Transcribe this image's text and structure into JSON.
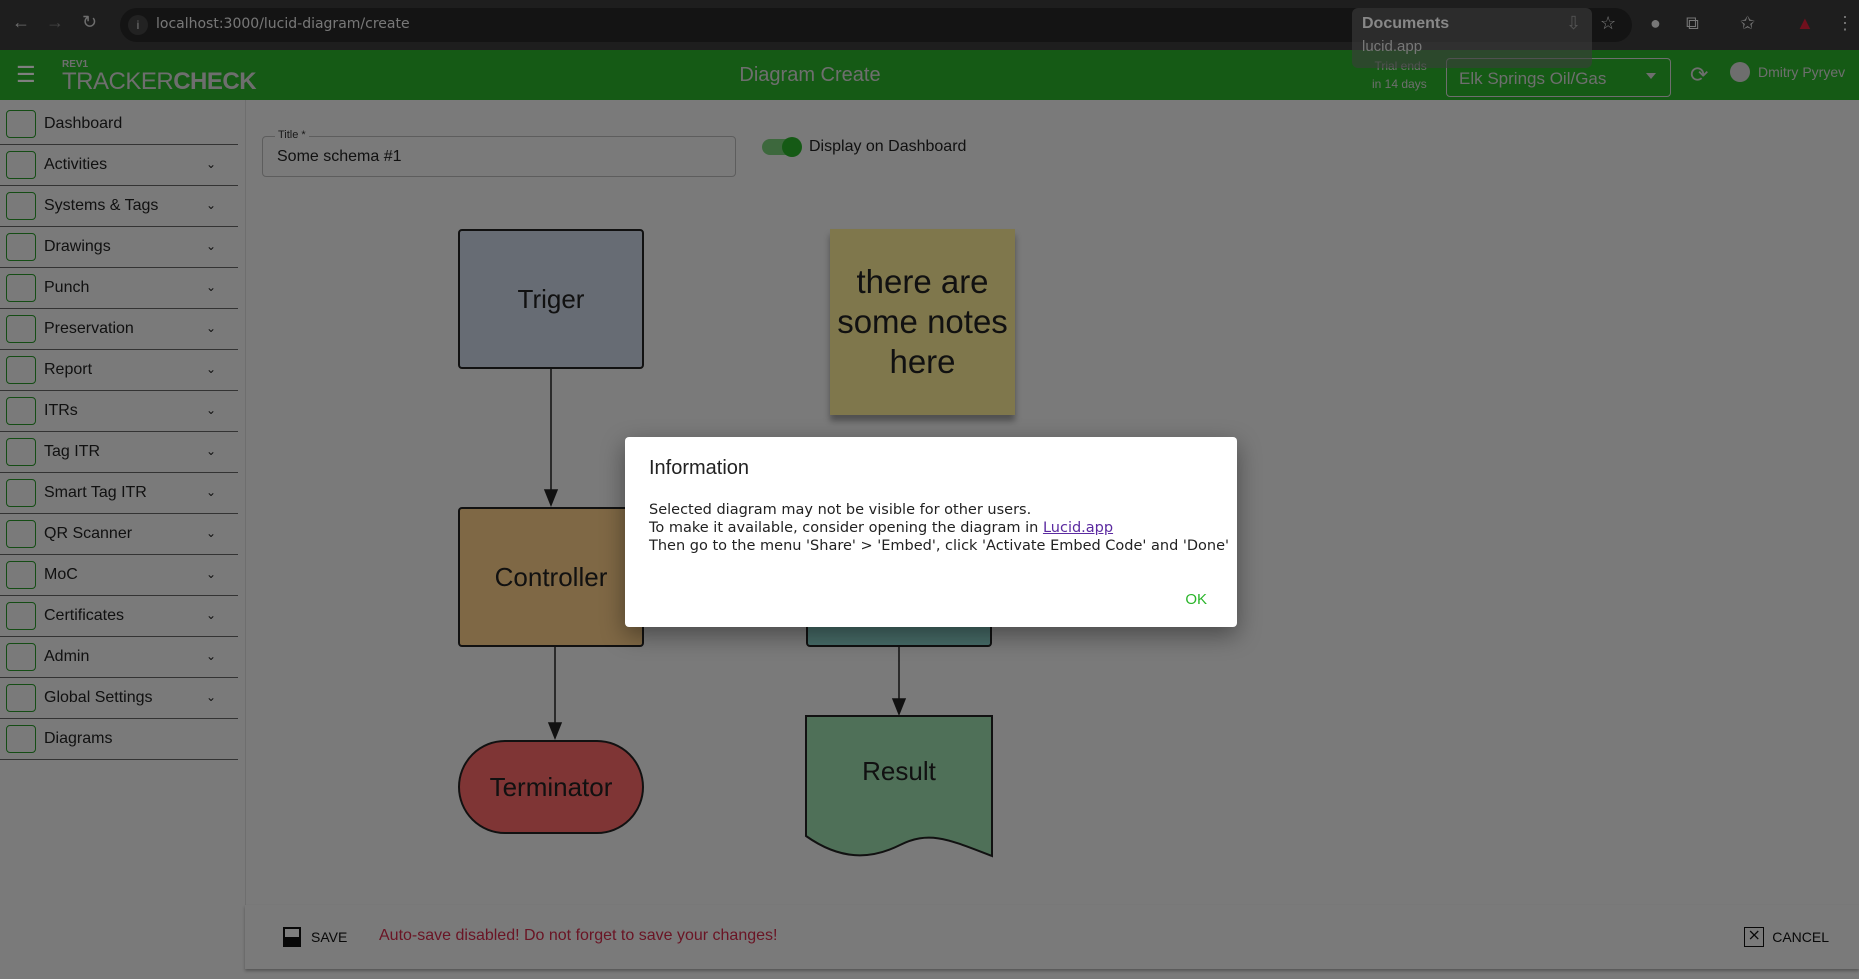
{
  "browser": {
    "url": "localhost:3000/lucid-diagram/create",
    "tooltip_title": "Documents",
    "tooltip_sub": "lucid.app"
  },
  "header": {
    "logo_rev": "REV1",
    "logo_a": "TRACKER",
    "logo_b": "CHECK",
    "title": "Diagram Create",
    "trial": [
      "Trial ends",
      "in 14 days"
    ],
    "project": "Elk Springs Oil/Gas",
    "user": "Dmitry Pyryev"
  },
  "sidebar": {
    "items": [
      {
        "label": "Dashboard",
        "icon": "dashboard-icon",
        "expand": false
      },
      {
        "label": "Activities",
        "icon": "calendar-icon",
        "expand": true
      },
      {
        "label": "Systems & Tags",
        "icon": "gears-icon",
        "expand": true
      },
      {
        "label": "Drawings",
        "icon": "image-icon",
        "expand": true
      },
      {
        "label": "Punch",
        "icon": "clipboard-check-icon",
        "expand": true
      },
      {
        "label": "Preservation",
        "icon": "fan-icon",
        "expand": true
      },
      {
        "label": "Report",
        "icon": "bar-chart-icon",
        "expand": true
      },
      {
        "label": "ITRs",
        "icon": "clipboard-list-icon",
        "expand": true
      },
      {
        "label": "Tag ITR",
        "icon": "document-icon",
        "expand": true
      },
      {
        "label": "Smart Tag ITR",
        "icon": "document-icon",
        "expand": true
      },
      {
        "label": "QR Scanner",
        "icon": "qr-icon",
        "expand": true
      },
      {
        "label": "MoC",
        "icon": "warning-icon",
        "expand": true
      },
      {
        "label": "Certificates",
        "icon": "badge-icon",
        "expand": true
      },
      {
        "label": "Admin",
        "icon": "user-lock-icon",
        "expand": true
      },
      {
        "label": "Global Settings",
        "icon": "user-lock-icon",
        "expand": true
      },
      {
        "label": "Diagrams",
        "icon": "image-icon",
        "expand": false
      }
    ]
  },
  "form": {
    "title_label": "Title *",
    "title_value": "Some schema #1",
    "toggle_label": "Display on Dashboard",
    "toggle_on": true
  },
  "diagram": {
    "triger": "Triger",
    "note": "there are some notes here",
    "controller": "Controller",
    "terminator": "Terminator",
    "result": "Result"
  },
  "footer": {
    "save": "SAVE",
    "warning": "Auto-save disabled! Do not forget to save your changes!",
    "cancel": "CANCEL"
  },
  "dialog": {
    "title": "Information",
    "line1": "Selected diagram may not be visible for other users.",
    "line2": "To make it available, consider opening the diagram in ",
    "link": "Lucid.app",
    "line3": "Then go to the menu 'Share' > 'Embed', click 'Activate Embed Code' and 'Done'",
    "ok": "OK"
  },
  "colors": {
    "brand": "#2ab52a",
    "warning": "#d42a4a",
    "link": "#5b2aa0"
  }
}
